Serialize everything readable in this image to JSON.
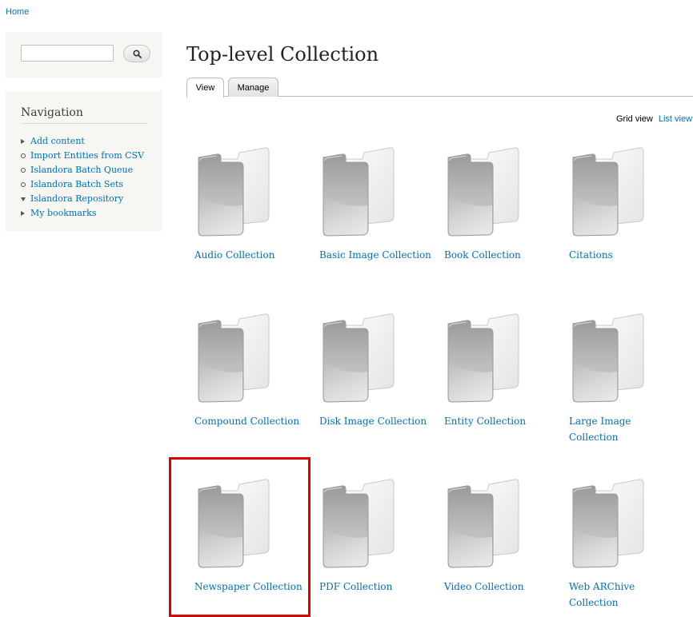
{
  "breadcrumb": {
    "home": "Home"
  },
  "search": {
    "value": "",
    "placeholder": ""
  },
  "navigation": {
    "title": "Navigation",
    "items": [
      {
        "label": "Add content",
        "bullet": "triangle-right"
      },
      {
        "label": "Import Entities from CSV",
        "bullet": "circle"
      },
      {
        "label": "Islandora Batch Queue",
        "bullet": "circle"
      },
      {
        "label": "Islandora Batch Sets",
        "bullet": "circle"
      },
      {
        "label": "Islandora Repository",
        "bullet": "triangle-down"
      },
      {
        "label": "My bookmarks",
        "bullet": "triangle-right"
      }
    ]
  },
  "page": {
    "title": "Top-level Collection"
  },
  "tabs": [
    {
      "label": "View",
      "active": true
    },
    {
      "label": "Manage",
      "active": false
    }
  ],
  "view_switch": {
    "grid": "Grid view",
    "list": "List view"
  },
  "collections": [
    {
      "label": "Audio Collection",
      "icon": "folder-icon"
    },
    {
      "label": "Basic Image Collection",
      "icon": "folder-icon"
    },
    {
      "label": "Book Collection",
      "icon": "folder-icon"
    },
    {
      "label": "Citations",
      "icon": "folder-icon"
    },
    {
      "label": "Compound Collection",
      "icon": "folder-icon"
    },
    {
      "label": "Disk Image Collection",
      "icon": "folder-icon"
    },
    {
      "label": "Entity Collection",
      "icon": "folder-icon"
    },
    {
      "label": "Large Image Collection",
      "icon": "folder-icon"
    },
    {
      "label": "Newspaper Collection",
      "icon": "folder-icon",
      "highlighted": true
    },
    {
      "label": "PDF Collection",
      "icon": "folder-icon"
    },
    {
      "label": "Video Collection",
      "icon": "folder-icon"
    },
    {
      "label": "Web ARChive Collection",
      "icon": "folder-icon"
    }
  ],
  "colors": {
    "link": "#0071b3",
    "highlight": "#e00000",
    "sidebar_bg": "#f6f6f2"
  }
}
